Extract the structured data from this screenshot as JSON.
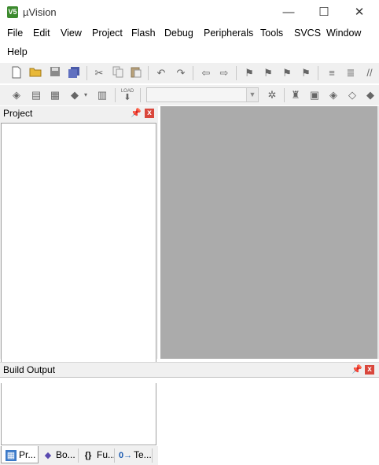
{
  "window": {
    "title": "µVision",
    "app_icon": "V5",
    "minimize_glyph": "—",
    "maximize_glyph": "☐",
    "close_glyph": "✕"
  },
  "menu": [
    "File",
    "Edit",
    "View",
    "Project",
    "Flash",
    "Debug",
    "Peripherals",
    "Tools",
    "SVCS",
    "Window",
    "Help"
  ],
  "toolbar1": {
    "icons": [
      "new-file-icon",
      "open-folder-icon",
      "save-icon",
      "save-all-icon",
      "cut-icon",
      "copy-icon",
      "paste-icon",
      "undo-icon",
      "redo-icon",
      "nav-back-icon",
      "nav-forward-icon",
      "bookmark-icon",
      "bookmark-prev-icon",
      "bookmark-next-icon",
      "bookmark-clear-icon",
      "indent-icon",
      "unindent-icon",
      "comment-icon"
    ]
  },
  "toolbar2": {
    "load_label": "LOAD",
    "target_value": "",
    "icons": [
      "translate-icon",
      "build-icon",
      "rebuild-icon",
      "batch-build-icon",
      "stop-build-icon",
      "download-icon",
      "target-options-icon",
      "manage-components-icon",
      "pack-installer-icon",
      "select-packs-icon",
      "event-recorder-icon"
    ]
  },
  "project_panel": {
    "title": "Project",
    "pin_glyph": "ꟾ",
    "close_glyph": "x",
    "tabs": [
      {
        "label": "Pr...",
        "icon": "project-tab-icon"
      },
      {
        "label": "Bo...",
        "icon": "books-tab-icon"
      },
      {
        "label": "Fu...",
        "icon": "functions-tab-icon",
        "glyph": "{}"
      },
      {
        "label": "Te...",
        "icon": "templates-tab-icon",
        "glyph": "0→"
      }
    ]
  },
  "build_output": {
    "title": "Build Output",
    "pin_glyph": "ꟾ",
    "close_glyph": "x"
  }
}
